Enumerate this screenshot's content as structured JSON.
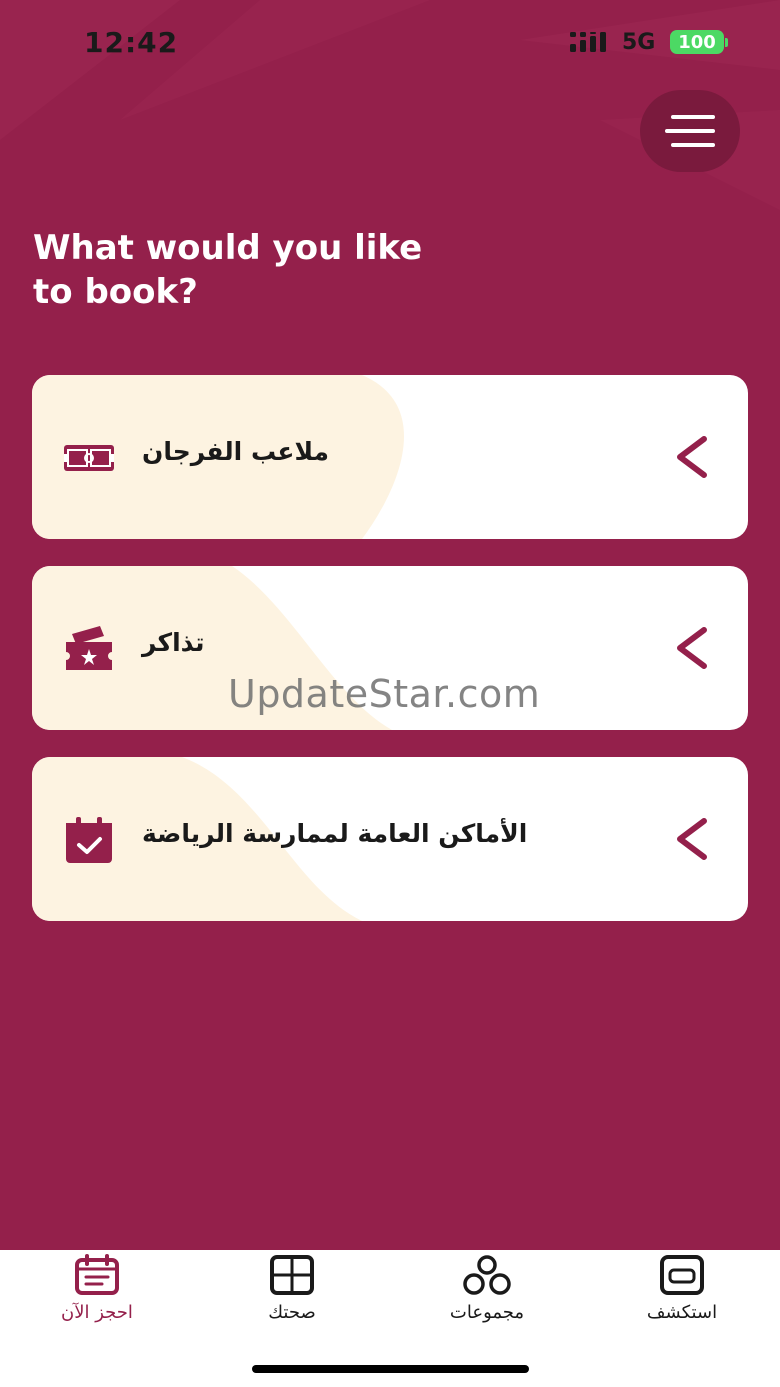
{
  "status_bar": {
    "time": "12:42",
    "network": "5G",
    "battery": "100"
  },
  "colors": {
    "brand": "#94204b",
    "card_tint": "#fdf3e1",
    "battery": "#4cd964"
  },
  "header": {
    "menu_icon": "hamburger-menu-icon"
  },
  "heading": {
    "line1": "What would you like",
    "line2": "to book?"
  },
  "cards": [
    {
      "label": "ملاعب الفرجان",
      "icon": "stadium-field-icon"
    },
    {
      "label": "تذاكر",
      "icon": "ticket-icon"
    },
    {
      "label": "الأماكن العامة لممارسة الرياضة",
      "icon": "calendar-check-icon"
    }
  ],
  "watermark": "UpdateStar.com",
  "bottom_nav": {
    "items": [
      {
        "label": "احجز الآن",
        "icon": "calendar-booking-icon",
        "active": true
      },
      {
        "label": "صحتك",
        "icon": "health-grid-icon",
        "active": false
      },
      {
        "label": "مجموعات",
        "icon": "groups-icon",
        "active": false
      },
      {
        "label": "استكشف",
        "icon": "explore-icon",
        "active": false
      }
    ]
  }
}
